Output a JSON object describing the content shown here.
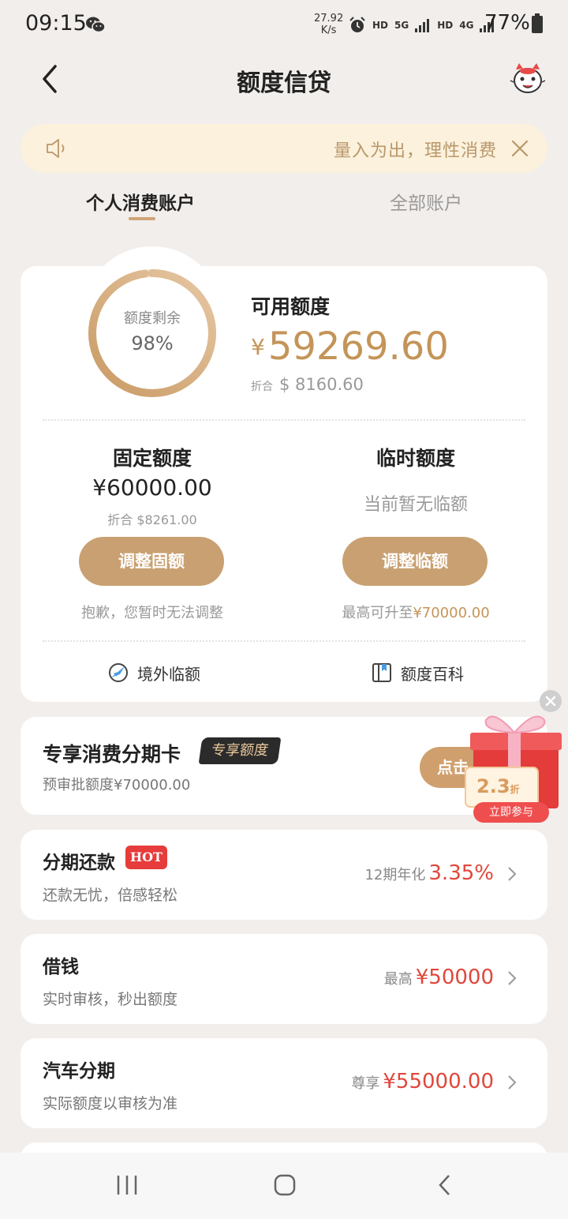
{
  "status_bar": {
    "time": "09:15",
    "net_speed_value": "27.92",
    "net_speed_unit": "K/s",
    "hd1": "HD",
    "net": "5G",
    "hd2": "HD",
    "net2": "4G",
    "battery": "77%"
  },
  "nav": {
    "title": "额度信贷"
  },
  "notice": {
    "text": "量入为出，理性消费"
  },
  "tabs": [
    {
      "label": "个人消费账户",
      "active": true
    },
    {
      "label": "全部账户",
      "active": false
    }
  ],
  "quota": {
    "ring_label": "额度剩余",
    "ring_value": "98%",
    "ring_fraction": 0.98,
    "available_label": "可用额度",
    "available_symbol": "¥",
    "available_amount": "59269.60",
    "conv_prefix": "折合",
    "conv_amount": "$ 8160.60",
    "fixed": {
      "title": "固定额度",
      "amount": "¥60000.00",
      "sub": "折合 $8261.00",
      "button": "调整固额",
      "note": "抱歉，您暂时无法调整"
    },
    "temp": {
      "title": "临时额度",
      "none_text": "当前暂无临额",
      "button": "调整临额",
      "note_prefix": "最高可升至",
      "note_amount": "¥70000.00"
    },
    "links": [
      {
        "label": "境外临额",
        "icon": "plane-icon"
      },
      {
        "label": "额度百科",
        "icon": "book-icon"
      }
    ]
  },
  "promo": {
    "title": "专享消费分期卡",
    "badge": "专享额度",
    "sub": "预审批额度¥70000.00",
    "button": "点击",
    "gift_discount": "2.3",
    "gift_discount_unit": "折",
    "gift_cta": "立即参与"
  },
  "rows": [
    {
      "title": "分期还款",
      "badge": "HOT",
      "sub": "还款无忧，倍感轻松",
      "right_label": "12期年化",
      "right_value": "3.35%"
    },
    {
      "title": "借钱",
      "sub": "实时审核，秒出额度",
      "right_label": "最高",
      "right_value": "¥50000"
    },
    {
      "title": "汽车分期",
      "sub": "实际额度以审核为准",
      "right_label": "尊享",
      "right_value": "¥55000.00"
    }
  ],
  "colors": {
    "accent": "#c9a071",
    "accent_text": "#c49458",
    "red": "#e0473b",
    "background": "#f2eeeb",
    "notice_bg": "#fbf1dc"
  }
}
